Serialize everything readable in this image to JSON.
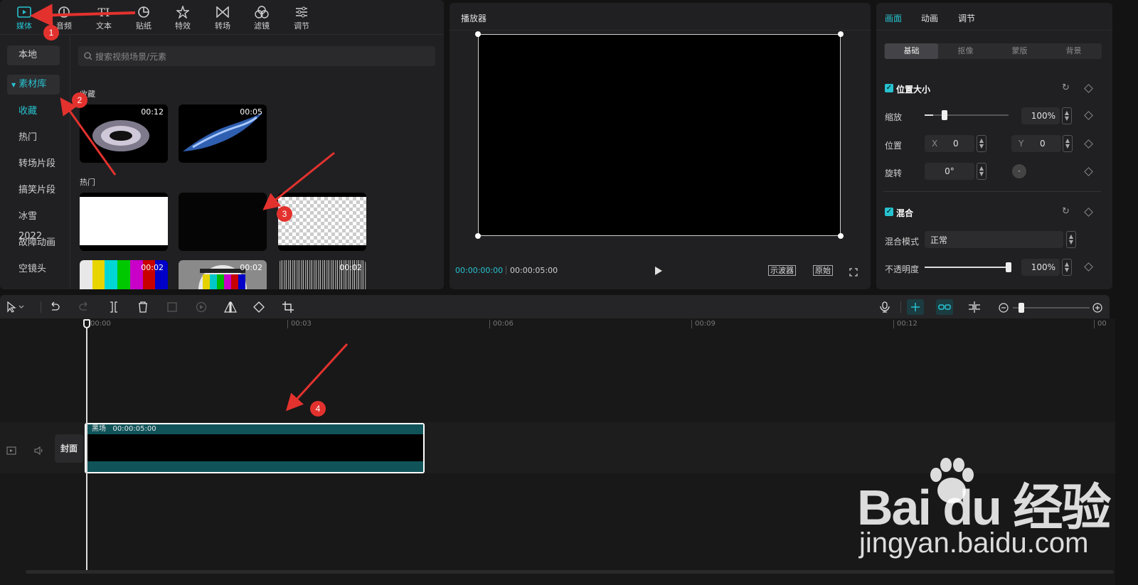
{
  "top_tabs": [
    {
      "label": "媒体",
      "icon": "media-icon",
      "active": true
    },
    {
      "label": "音频",
      "icon": "audio-icon"
    },
    {
      "label": "文本",
      "icon": "text-icon"
    },
    {
      "label": "贴纸",
      "icon": "sticker-icon"
    },
    {
      "label": "特效",
      "icon": "effects-icon"
    },
    {
      "label": "转场",
      "icon": "transition-icon"
    },
    {
      "label": "滤镜",
      "icon": "filter-icon"
    },
    {
      "label": "调节",
      "icon": "adjust-icon"
    }
  ],
  "sidebar": {
    "local": "本地",
    "library": "素材库",
    "items": [
      "收藏",
      "热门",
      "转场片段",
      "搞笑片段",
      "冰雪2022",
      "故障动画",
      "空镜头"
    ]
  },
  "search": {
    "placeholder": "搜索视频场景/元素"
  },
  "media": {
    "favorites_title": "收藏",
    "favorites": [
      {
        "duration": "00:12"
      },
      {
        "duration": "00:05"
      }
    ],
    "hot_title": "热门",
    "hot_row2_durations": [
      "00:02",
      "00:02",
      "00:02"
    ]
  },
  "player": {
    "title": "播放器",
    "current_time": "00:00:00:00",
    "total_time": "00:00:05:00",
    "scope_btn": "示波器",
    "original_btn": "原始"
  },
  "inspector": {
    "tabs": [
      "画面",
      "动画",
      "调节"
    ],
    "subtabs": [
      "基础",
      "抠像",
      "蒙版",
      "背景"
    ],
    "position_size": "位置大小",
    "scale_label": "缩放",
    "scale_value": "100%",
    "scale_level": 0.1,
    "position_label": "位置",
    "x_label": "X",
    "x_value": "0",
    "y_label": "Y",
    "y_value": "0",
    "rotate_label": "旋转",
    "rotate_value": "0°",
    "blend_section": "混合",
    "blend_mode_label": "混合模式",
    "blend_mode_value": "正常",
    "opacity_label": "不透明度",
    "opacity_value": "100%",
    "opacity_level": 1.0
  },
  "timeline": {
    "ticks": [
      "00:00",
      "00:03",
      "00:06",
      "00:09",
      "00:12",
      "00"
    ],
    "cover_label": "封面",
    "clip_name": "黑场",
    "clip_duration": "00:00:05:00"
  },
  "badges": [
    "1",
    "2",
    "3",
    "4"
  ],
  "watermark": {
    "brand": "Bai du 经验",
    "url": "jingyan.baidu.com"
  },
  "colors": {
    "accent": "#27c2cf",
    "clip": "#10545a",
    "badge": "#e3322e"
  }
}
